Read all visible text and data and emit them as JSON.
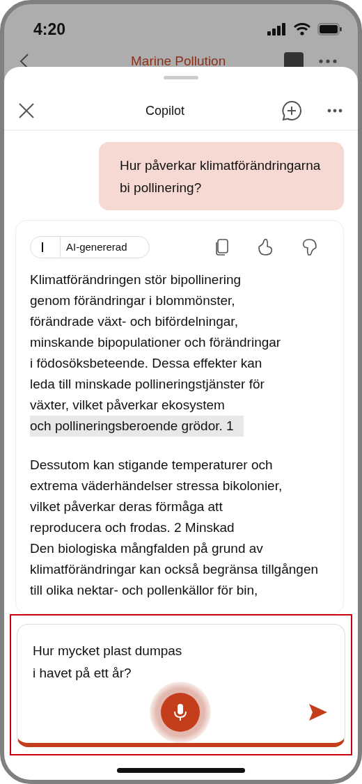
{
  "status_bar": {
    "time": "4:20"
  },
  "document_header": {
    "title": "Marine Pollution"
  },
  "sheet": {
    "title": "Copilot"
  },
  "user_message": {
    "text": "Hur påverkar klimatförändringarna\nbi pollinering?"
  },
  "response": {
    "label": "AI-genererad",
    "paragraphs": [
      {
        "segments": [
          {
            "text": "Klimatförändringen stör bipollinering\ngenom förändringar i blommönster,\nförändrade växt- och bifördelningar,\nminskande bipopulationer och förändringar\ni födosöksbeteende. Dessa effekter kan\nleda till minskade pollineringstjänster för\nväxter, vilket påverkar ekosystem",
            "highlighted": false
          },
          {
            "text": "och pollineringsberoende grödor. 1",
            "highlighted": true
          }
        ]
      },
      {
        "segments": [
          {
            "text": "Dessutom kan stigande temperaturer och\nextrema väderhändelser stressa bikolonier,\nvilket påverkar deras förmåga att\nreproducera och frodas. 2    Minskad\nDen biologiska mångfalden på grund av\nklimatförändringar kan också begränsa tillgången\ntill olika nektar- och pollenkällor för bin,",
            "highlighted": false
          }
        ]
      }
    ]
  },
  "composer": {
    "value": "Hur mycket plast dumpas\ni havet på ett år?"
  }
}
